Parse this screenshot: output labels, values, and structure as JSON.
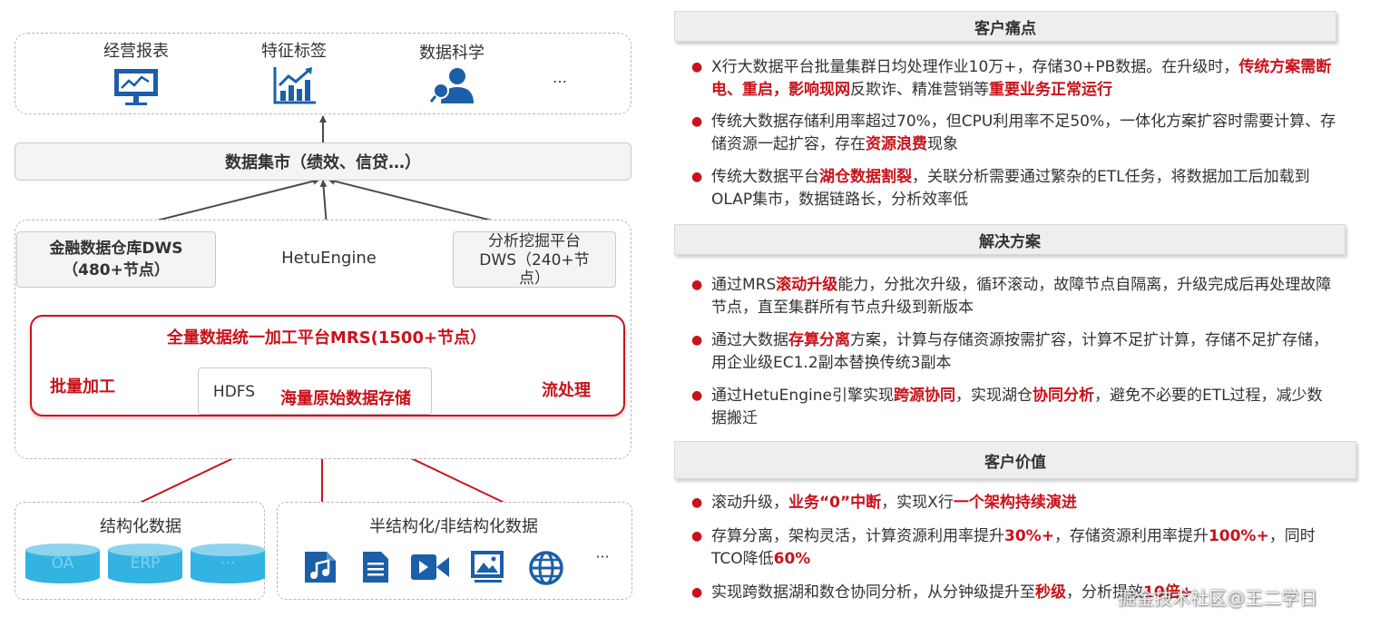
{
  "diagram": {
    "apps": [
      {
        "label": "经营报表",
        "icon": "presentation-board-icon"
      },
      {
        "label": "特征标签",
        "icon": "growth-chart-icon"
      },
      {
        "label": "数据科学",
        "icon": "data-scientist-icon"
      },
      {
        "label": "…",
        "icon": ""
      }
    ],
    "mart_label": "数据集市（绩效、信贷…）",
    "dws_left_line1": "金融数据仓库DWS",
    "dws_left_line2": "（480+节点）",
    "hetu_label": "HetuEngine",
    "dws_right_line1": "分析挖掘平台",
    "dws_right_line2": "DWS（240+节",
    "dws_right_line3": "点）",
    "mrs_title": "全量数据统一加工平台MRS(1500+节点）",
    "batch_label": "批量加工",
    "stream_label": "流处理",
    "hdfs_label": "HDFS",
    "storage_label": "海量原始数据存储",
    "structured_title": "结构化数据",
    "structured_items": [
      "OA",
      "ERP",
      "···"
    ],
    "semi_title": "半结构化/非结构化数据",
    "semi_icons": [
      "music-file-icon",
      "document-icon",
      "video-icon",
      "image-icon",
      "globe-icon"
    ],
    "semi_more": "···",
    "accent_color": "#c8131b",
    "icon_color": "#1b5fa8",
    "db_color": "#33b3e2"
  },
  "sections": [
    {
      "title": "客户痛点",
      "bullets": [
        [
          {
            "t": "X行大数据平台批量集群日均处理作业10万+，存储30+PB数据。在升级时，"
          },
          {
            "t": "传统方案需断电、重启，影响现网",
            "hl": true
          },
          {
            "t": "反欺诈、精准营销等"
          },
          {
            "t": "重要业务正常运行",
            "hl": true
          }
        ],
        [
          {
            "t": "传统大数据存储利用率超过70%，但CPU利用率不足50%，一体化方案扩容时需要计算、存储资源一起扩容，存在"
          },
          {
            "t": "资源浪费",
            "hl": true
          },
          {
            "t": "现象"
          }
        ],
        [
          {
            "t": "传统大数据平台"
          },
          {
            "t": "湖仓数据割裂",
            "hl": true
          },
          {
            "t": "，关联分析需要通过繁杂的ETL任务，将数据加工后加载到OLAP集市，数据链路长，分析效率低"
          }
        ]
      ]
    },
    {
      "title": "解决方案",
      "bullets": [
        [
          {
            "t": "通过MRS"
          },
          {
            "t": "滚动升级",
            "hl": true
          },
          {
            "t": "能力，分批次升级，循环滚动，故障节点自隔离，升级完成后再处理故障节点，直至集群所有节点升级到新版本"
          }
        ],
        [
          {
            "t": "通过大数据"
          },
          {
            "t": "存算分离",
            "hl": true
          },
          {
            "t": "方案，计算与存储资源按需扩容，计算不足扩计算，存储不足扩存储，用企业级EC1.2副本替换传统3副本"
          }
        ],
        [
          {
            "t": "通过HetuEngine引擎实现"
          },
          {
            "t": "跨源协同",
            "hl": true
          },
          {
            "t": "，实现湖仓"
          },
          {
            "t": "协同分析",
            "hl": true
          },
          {
            "t": "，避免不必要的ETL过程，减少数据搬迁"
          }
        ]
      ]
    },
    {
      "title": "客户价值",
      "bullets": [
        [
          {
            "t": "滚动升级，"
          },
          {
            "t": "业务“0”中断",
            "hl": true
          },
          {
            "t": "，实现X行"
          },
          {
            "t": "一个架构持续演进",
            "hl": true
          }
        ],
        [
          {
            "t": "存算分离，架构灵活，计算资源利用率提升"
          },
          {
            "t": "30%+",
            "hl": true
          },
          {
            "t": "，存储资源利用率提升"
          },
          {
            "t": "100%+",
            "hl": true
          },
          {
            "t": "，同时TCO降低"
          },
          {
            "t": "60%",
            "hl": true
          }
        ],
        [
          {
            "t": "实现跨数据湖和数仓协同分析，从分钟级提升至"
          },
          {
            "t": "秒级",
            "hl": true
          },
          {
            "t": "，分析提效"
          },
          {
            "t": "10倍+",
            "hl": true
          }
        ]
      ]
    }
  ],
  "watermark": "掘金技术社区@王二学日"
}
